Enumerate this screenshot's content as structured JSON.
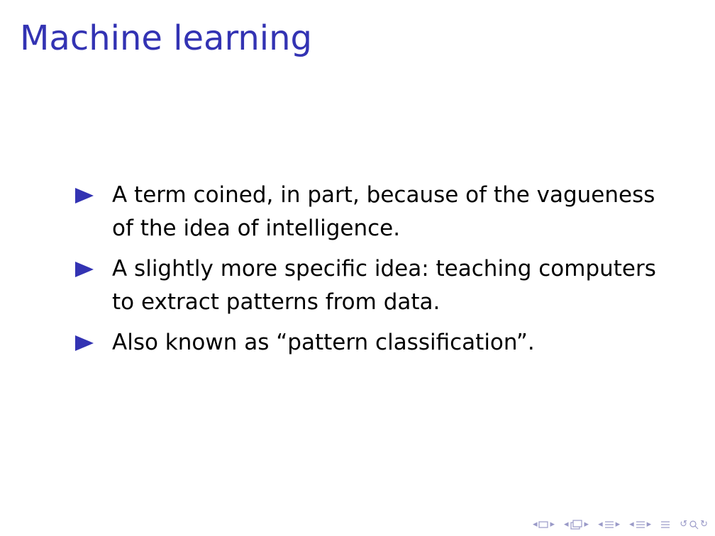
{
  "slide": {
    "title": "Machine learning",
    "bullets": [
      "A term coined, in part, because of the vagueness of the idea of intelligence.",
      "A slightly more specific idea: teaching computers to extract patterns from data.",
      "Also known as “pattern classification”."
    ]
  },
  "colors": {
    "accent": "#3333b3",
    "text": "#000000",
    "navigation": "#9a9ac8",
    "background": "#ffffff"
  },
  "navigation": {
    "icons": [
      "nav-prev-frame-icon",
      "frame-icon",
      "nav-next-frame-icon",
      "nav-prev-subsection-icon",
      "subsection-icon",
      "nav-next-subsection-icon",
      "nav-prev-section-icon",
      "section-icon",
      "nav-next-section-icon",
      "document-icon",
      "search-icon",
      "back-icon",
      "forward-icon"
    ]
  }
}
